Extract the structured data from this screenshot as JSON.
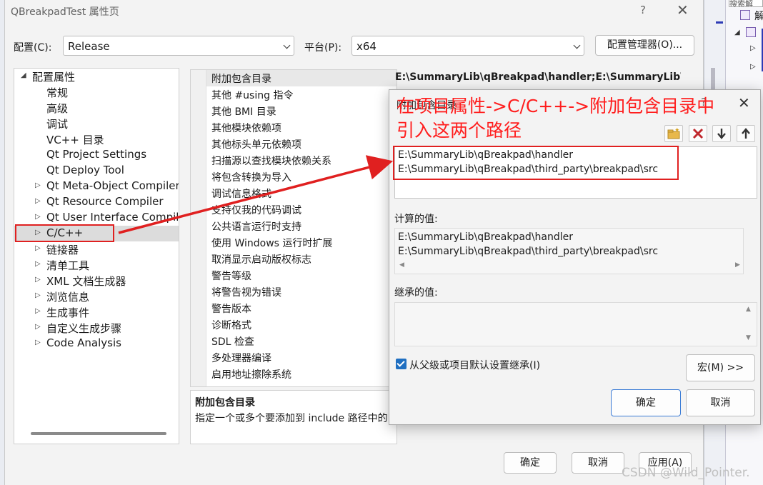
{
  "window": {
    "title": "QBreakpadTest 属性页",
    "help_glyph": "?",
    "close_glyph": "✕"
  },
  "config": {
    "label": "配置(C):",
    "value": "Release",
    "platform_label": "平台(P):",
    "platform_value": "x64",
    "manager_button": "配置管理器(O)..."
  },
  "tree": {
    "root": "配置属性",
    "items": [
      {
        "label": "常规",
        "expandable": false
      },
      {
        "label": "高级",
        "expandable": false
      },
      {
        "label": "调试",
        "expandable": false
      },
      {
        "label": "VC++ 目录",
        "expandable": false
      },
      {
        "label": "Qt Project Settings",
        "expandable": false
      },
      {
        "label": "Qt Deploy Tool",
        "expandable": false
      },
      {
        "label": "Qt Meta-Object Compiler",
        "expandable": true
      },
      {
        "label": "Qt Resource Compiler",
        "expandable": true
      },
      {
        "label": "Qt User Interface Compile",
        "expandable": true
      },
      {
        "label": "C/C++",
        "expandable": true,
        "selected": true
      },
      {
        "label": "链接器",
        "expandable": true
      },
      {
        "label": "清单工具",
        "expandable": true
      },
      {
        "label": "XML 文档生成器",
        "expandable": true
      },
      {
        "label": "浏览信息",
        "expandable": true
      },
      {
        "label": "生成事件",
        "expandable": true
      },
      {
        "label": "自定义生成步骤",
        "expandable": true
      },
      {
        "label": "Code Analysis",
        "expandable": true
      }
    ]
  },
  "grid": {
    "rows": [
      "附加包含目录",
      "其他 #using 指令",
      "其他 BMI 目录",
      "其他模块依赖项",
      "其他标头单元依赖项",
      "扫描源以查找模块依赖关系",
      "将包含转换为导入",
      "调试信息格式",
      "支持仅我的代码调试",
      "公共语言运行时支持",
      "使用 Windows 运行时扩展",
      "取消显示启动版权标志",
      "警告等级",
      "将警告视为错误",
      "警告版本",
      "诊断格式",
      "SDL 检查",
      "多处理器编译",
      "启用地址擦除系统"
    ],
    "selected_value": "E:\\SummaryLib\\qBreakpad\\handler;E:\\SummaryLib\\qBreakpad\\third_party\\breakpad\\src"
  },
  "description": {
    "title": "附加包含目录",
    "text": "指定一个或多个要添加到 include 路径中的目录"
  },
  "bottom_buttons": {
    "ok": "确定",
    "cancel": "取消",
    "apply": "应用(A)"
  },
  "dialog": {
    "title": "附加包含目录",
    "help_glyph": "?",
    "close_glyph": "✕",
    "entries": [
      "E:\\SummaryLib\\qBreakpad\\handler",
      "E:\\SummaryLib\\qBreakpad\\third_party\\breakpad\\src"
    ],
    "computed_label": "计算的值:",
    "computed": [
      "E:\\SummaryLib\\qBreakpad\\handler",
      "E:\\SummaryLib\\qBreakpad\\third_party\\breakpad\\src"
    ],
    "inherited_label": "继承的值:",
    "inherit_checkbox": "从父级或项目默认设置继承(I)",
    "inherit_checked": true,
    "macro_button": "宏(M) >>",
    "ok": "确定",
    "cancel": "取消"
  },
  "annotation": {
    "line1": "在项目属性->C/C++->附加包含目录中",
    "line2": "引入这两个路径",
    "color": "#ff1e1e"
  },
  "right_strip": {
    "search_text": "搜索解",
    "item_text": "解"
  },
  "watermark": "CSDN @Wild_Pointer."
}
